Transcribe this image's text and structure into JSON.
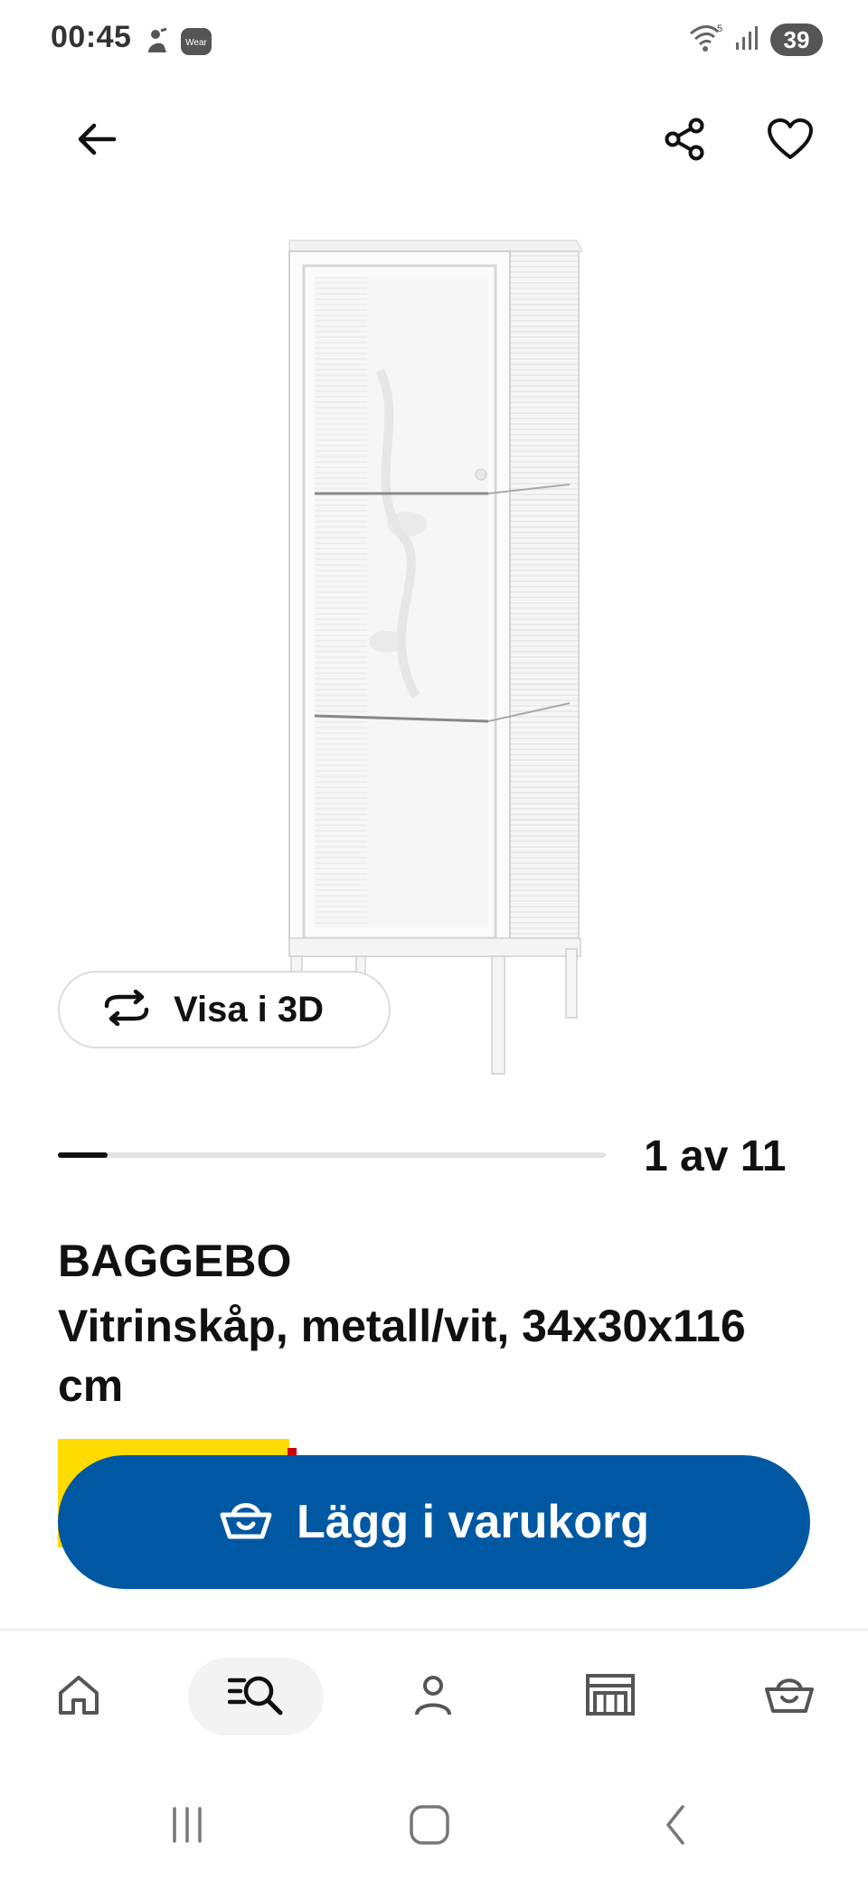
{
  "status_bar": {
    "time": "00:45",
    "left_icons": [
      "notification-icon",
      "wear-icon"
    ],
    "wear_label": "Wear",
    "wifi_badge": "5",
    "battery": "39"
  },
  "app_bar": {
    "icons": [
      "back-arrow-icon",
      "share-icon",
      "heart-icon"
    ]
  },
  "gallery": {
    "view3d_label": "Visa i 3D",
    "position_text": "1 av 11",
    "current": 1,
    "total": 11
  },
  "product": {
    "name": "BAGGEBO",
    "description": "Vitrinskåp, metall/vit, 34x30x116 cm"
  },
  "actions": {
    "add_to_cart_label": "Lägg i varukorg",
    "price_tag_color": "#ffdb00",
    "button_color": "#0058a3"
  },
  "bottom_nav": {
    "items": [
      {
        "name": "home",
        "icon": "home-icon",
        "active": false
      },
      {
        "name": "search",
        "icon": "search-list-icon",
        "active": true
      },
      {
        "name": "profile",
        "icon": "person-icon",
        "active": false
      },
      {
        "name": "store",
        "icon": "store-icon",
        "active": false
      },
      {
        "name": "cart",
        "icon": "basket-icon",
        "active": false
      }
    ]
  },
  "system_nav": {
    "icons": [
      "recents-icon",
      "home-button-icon",
      "back-icon"
    ]
  }
}
